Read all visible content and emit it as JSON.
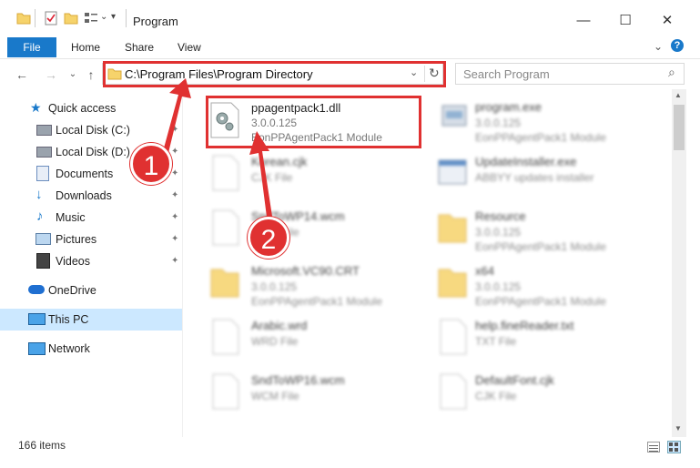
{
  "window": {
    "title": "Program",
    "minimize": "—",
    "maximize": "☐",
    "close": "✕",
    "chevron": "⌄",
    "help": "?"
  },
  "ribbon": {
    "tabs": [
      "File",
      "Home",
      "Share",
      "View"
    ]
  },
  "nav": {
    "back": "←",
    "forward": "→",
    "recent": "⌄",
    "up": "↑",
    "address": "C:\\Program Files\\Program Directory",
    "dropdown": "⌄",
    "refresh": "↻",
    "search_placeholder": "Search Program",
    "search_glyph": "⌕"
  },
  "sidebar": {
    "items": [
      {
        "label": "Quick access",
        "icon": "star-icon",
        "pinned": false
      },
      {
        "label": "Local Disk (C:)",
        "icon": "drive-icon",
        "pinned": true
      },
      {
        "label": "Local Disk (D:)",
        "icon": "drive-icon",
        "pinned": true
      },
      {
        "label": "Documents",
        "icon": "documents-icon",
        "pinned": true
      },
      {
        "label": "Downloads",
        "icon": "download-icon",
        "pinned": true
      },
      {
        "label": "Music",
        "icon": "music-icon",
        "pinned": true
      },
      {
        "label": "Pictures",
        "icon": "pictures-icon",
        "pinned": true
      },
      {
        "label": "Videos",
        "icon": "videos-icon",
        "pinned": true
      },
      {
        "label": "OneDrive",
        "icon": "cloud-icon",
        "pinned": false
      },
      {
        "label": "This PC",
        "icon": "pc-icon",
        "pinned": false
      },
      {
        "label": "Network",
        "icon": "network-icon",
        "pinned": false
      }
    ],
    "pin_glyph": "✦"
  },
  "files": [
    {
      "name": "ppagentpack1.dll",
      "line2": "3.0.0.125",
      "line3": "EonPPAgentPack1 Module",
      "icon": "dll-gear-icon"
    },
    {
      "name": "program.exe",
      "line2": "3.0.0.125",
      "line3": "EonPPAgentPack1 Module",
      "icon": "exe-icon"
    },
    {
      "name": "Korean.cjk",
      "line2": "CJK File",
      "line3": "",
      "icon": "file-icon"
    },
    {
      "name": "UpdateInstaller.exe",
      "line2": "ABBYY updates installer",
      "line3": "",
      "icon": "installer-icon"
    },
    {
      "name": "SndToWP14.wcm",
      "line2": "WCM File",
      "line3": "",
      "icon": "file-icon"
    },
    {
      "name": "Resource",
      "line2": "3.0.0.125",
      "line3": "EonPPAgentPack1 Module",
      "icon": "folder-icon"
    },
    {
      "name": "Microsoft.VC90.CRT",
      "line2": "3.0.0.125",
      "line3": "EonPPAgentPack1 Module",
      "icon": "folder-icon"
    },
    {
      "name": "x64",
      "line2": "3.0.0.125",
      "line3": "EonPPAgentPack1 Module",
      "icon": "folder-icon"
    },
    {
      "name": "Arabic.wrd",
      "line2": "WRD File",
      "line3": "",
      "icon": "file-icon"
    },
    {
      "name": "help.fineReader.txt",
      "line2": "TXT File",
      "line3": "",
      "icon": "file-icon"
    },
    {
      "name": "SndToWP16.wcm",
      "line2": "WCM File",
      "line3": "",
      "icon": "file-icon"
    },
    {
      "name": "DefaultFont.cjk",
      "line2": "CJK File",
      "line3": "",
      "icon": "file-icon"
    }
  ],
  "status": {
    "item_count": "166 items"
  },
  "annotations": {
    "step1": "1",
    "step2": "2",
    "color": "#e03131"
  },
  "colors": {
    "accent": "#1979ca",
    "selected": "#cce8ff",
    "annotation": "#e03131"
  }
}
